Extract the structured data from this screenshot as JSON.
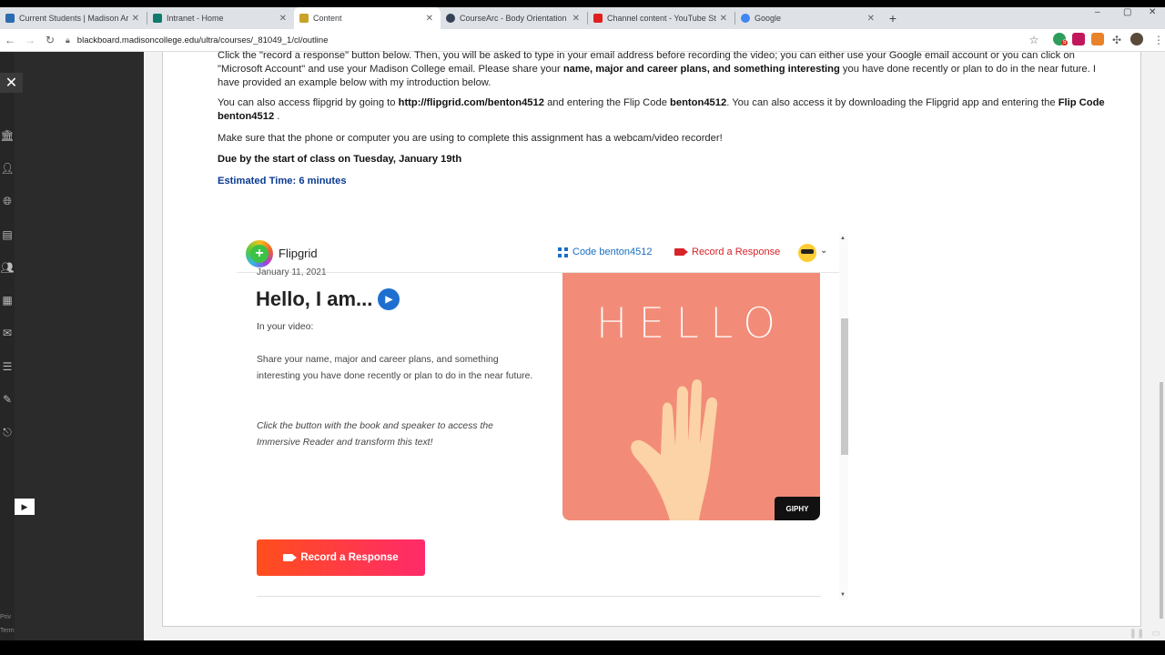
{
  "browser": {
    "tabs": [
      {
        "title": "Current Students | Madison Area",
        "color": "#2b6cb0"
      },
      {
        "title": "Intranet - Home",
        "color": "#0f7b6c"
      },
      {
        "title": "Content",
        "color": "#c9a227",
        "active": true
      },
      {
        "title": "CourseArc - Body Orientation an",
        "color": "#334155"
      },
      {
        "title": "Channel content - YouTube Studi",
        "color": "#e02020"
      },
      {
        "title": "Google",
        "color": "#4285f4"
      }
    ],
    "url": "blackboard.madisoncollege.edu/ultra/courses/_81049_1/cl/outline",
    "new_tab": "+",
    "window_controls": [
      "–",
      "▢",
      "✕"
    ],
    "extension_badge": "5"
  },
  "left_rail": {
    "close": "✕",
    "footer_1": "Priv",
    "footer_2": "Term",
    "play": "▶"
  },
  "content": {
    "p1_line1": "Click the \"record a response\" button below.  Then, you will be asked to type in your email address before recording the video; you can either use your Google email account or you can click on",
    "p1_line2_a": "\"Microsoft Account\" and use your Madison College email.  Please share your ",
    "p1_line2_b": "name, major and career plans, and something interesting",
    "p1_line2_c": " you have done recently or plan to do in the near future.  I",
    "p1_line3": "have provided an example below with my introduction below.",
    "p2_a": "You can also access flipgrid by going to ",
    "p2_b": "http://flipgrid.com/benton4512",
    "p2_c": " and entering the Flip Code ",
    "p2_d": "benton4512",
    "p2_e": ".  You can also access it by downloading the Flipgrid app and entering the ",
    "p2_f": "Flip Code",
    "p2_g": "benton4512",
    "p2_h": " .",
    "p3": "Make sure that the phone or computer you are using to complete this assignment has a webcam/video recorder!",
    "due": "Due by the start of class on Tuesday, January 19th",
    "estimated": "Estimated Time: 6 minutes"
  },
  "flipgrid": {
    "brand": "Flipgrid",
    "code_label": "Code benton4512",
    "record_top": "Record a Response",
    "date": "January 11, 2021",
    "hello": "Hello, I am...",
    "in_video": "In your video:",
    "prompt_1": "Share your name, major and career plans, and something",
    "prompt_2": "interesting you have done recently or plan to do in the near future.",
    "ir_1": "Click the button with the book and speaker to access the",
    "ir_2": "Immersive Reader and transform this text!",
    "gif_text": "HELLO",
    "giphy": "GIPHY",
    "record_button": "Record a Response"
  },
  "colors": {
    "brand_red": "#d8232a",
    "link_blue": "#1a6fc2",
    "estimate_blue": "#0a3a91",
    "gif_bg": "#f28c78"
  }
}
